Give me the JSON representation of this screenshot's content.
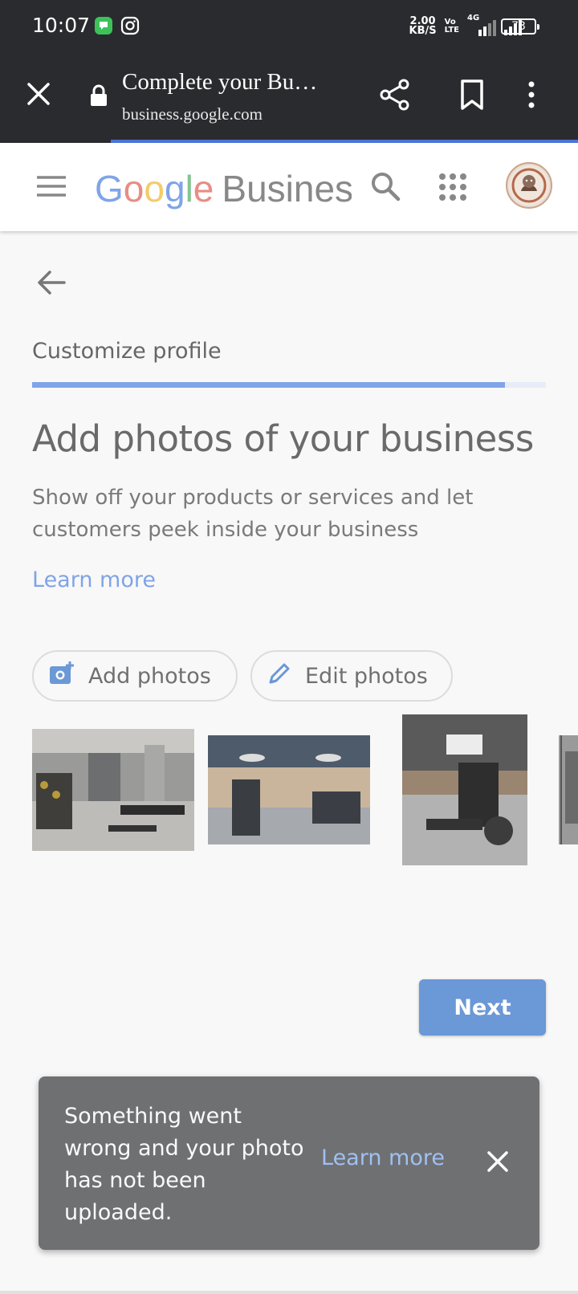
{
  "status_bar": {
    "time": "10:07",
    "net_speed_value": "2.00",
    "net_speed_unit": "KB/S",
    "volte_top": "Vo",
    "volte_bottom": "LTE",
    "network": "4G",
    "battery": "73"
  },
  "browser": {
    "page_title": "Complete your Bu…",
    "url": "business.google.com"
  },
  "app_bar": {
    "logo_letters": [
      "G",
      "o",
      "o",
      "g",
      "l",
      "e"
    ],
    "logo_suffix": "Business"
  },
  "onboarding": {
    "step_label": "Customize profile",
    "step_progress": 0.92,
    "heading": "Add photos of your business",
    "description": "Show off your products or services and let customers peek inside your business",
    "learn_more": "Learn more",
    "add_photos_label": "Add photos",
    "edit_photos_label": "Edit photos",
    "photos": [
      {
        "name": "gym-photo-1"
      },
      {
        "name": "gym-photo-2"
      },
      {
        "name": "gym-photo-3"
      },
      {
        "name": "gym-photo-4"
      }
    ],
    "next_label": "Next"
  },
  "snackbar": {
    "message": "Something went wrong and your photo has not been uploaded.",
    "action_label": "Learn more"
  },
  "colors": {
    "accent": "#7fa4e8",
    "button_blue": "#6b98d6",
    "toolbar_bg": "#2a2b2f",
    "snackbar_bg": "#6f7072"
  },
  "icons": [
    "message-icon",
    "instagram-icon",
    "signal-icon",
    "battery-icon",
    "close-icon",
    "lock-icon",
    "share-icon",
    "bookmark-icon",
    "more-vert-icon",
    "menu-icon",
    "search-icon",
    "apps-icon",
    "back-arrow-icon",
    "add-photo-icon",
    "pencil-icon"
  ]
}
